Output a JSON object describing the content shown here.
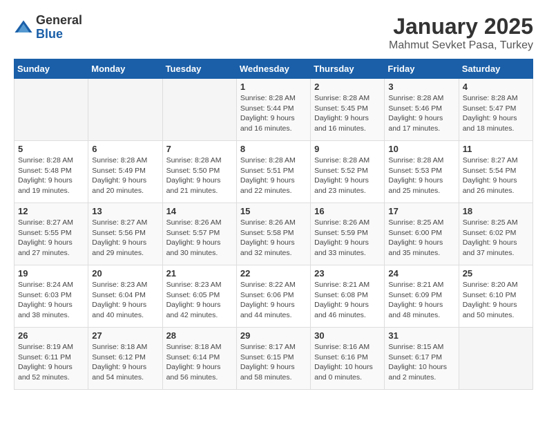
{
  "logo": {
    "general": "General",
    "blue": "Blue"
  },
  "title": "January 2025",
  "subtitle": "Mahmut Sevket Pasa, Turkey",
  "days_of_week": [
    "Sunday",
    "Monday",
    "Tuesday",
    "Wednesday",
    "Thursday",
    "Friday",
    "Saturday"
  ],
  "weeks": [
    [
      {
        "day": "",
        "sunrise": "",
        "sunset": "",
        "daylight": ""
      },
      {
        "day": "",
        "sunrise": "",
        "sunset": "",
        "daylight": ""
      },
      {
        "day": "",
        "sunrise": "",
        "sunset": "",
        "daylight": ""
      },
      {
        "day": "1",
        "sunrise": "Sunrise: 8:28 AM",
        "sunset": "Sunset: 5:44 PM",
        "daylight": "Daylight: 9 hours and 16 minutes."
      },
      {
        "day": "2",
        "sunrise": "Sunrise: 8:28 AM",
        "sunset": "Sunset: 5:45 PM",
        "daylight": "Daylight: 9 hours and 16 minutes."
      },
      {
        "day": "3",
        "sunrise": "Sunrise: 8:28 AM",
        "sunset": "Sunset: 5:46 PM",
        "daylight": "Daylight: 9 hours and 17 minutes."
      },
      {
        "day": "4",
        "sunrise": "Sunrise: 8:28 AM",
        "sunset": "Sunset: 5:47 PM",
        "daylight": "Daylight: 9 hours and 18 minutes."
      }
    ],
    [
      {
        "day": "5",
        "sunrise": "Sunrise: 8:28 AM",
        "sunset": "Sunset: 5:48 PM",
        "daylight": "Daylight: 9 hours and 19 minutes."
      },
      {
        "day": "6",
        "sunrise": "Sunrise: 8:28 AM",
        "sunset": "Sunset: 5:49 PM",
        "daylight": "Daylight: 9 hours and 20 minutes."
      },
      {
        "day": "7",
        "sunrise": "Sunrise: 8:28 AM",
        "sunset": "Sunset: 5:50 PM",
        "daylight": "Daylight: 9 hours and 21 minutes."
      },
      {
        "day": "8",
        "sunrise": "Sunrise: 8:28 AM",
        "sunset": "Sunset: 5:51 PM",
        "daylight": "Daylight: 9 hours and 22 minutes."
      },
      {
        "day": "9",
        "sunrise": "Sunrise: 8:28 AM",
        "sunset": "Sunset: 5:52 PM",
        "daylight": "Daylight: 9 hours and 23 minutes."
      },
      {
        "day": "10",
        "sunrise": "Sunrise: 8:28 AM",
        "sunset": "Sunset: 5:53 PM",
        "daylight": "Daylight: 9 hours and 25 minutes."
      },
      {
        "day": "11",
        "sunrise": "Sunrise: 8:27 AM",
        "sunset": "Sunset: 5:54 PM",
        "daylight": "Daylight: 9 hours and 26 minutes."
      }
    ],
    [
      {
        "day": "12",
        "sunrise": "Sunrise: 8:27 AM",
        "sunset": "Sunset: 5:55 PM",
        "daylight": "Daylight: 9 hours and 27 minutes."
      },
      {
        "day": "13",
        "sunrise": "Sunrise: 8:27 AM",
        "sunset": "Sunset: 5:56 PM",
        "daylight": "Daylight: 9 hours and 29 minutes."
      },
      {
        "day": "14",
        "sunrise": "Sunrise: 8:26 AM",
        "sunset": "Sunset: 5:57 PM",
        "daylight": "Daylight: 9 hours and 30 minutes."
      },
      {
        "day": "15",
        "sunrise": "Sunrise: 8:26 AM",
        "sunset": "Sunset: 5:58 PM",
        "daylight": "Daylight: 9 hours and 32 minutes."
      },
      {
        "day": "16",
        "sunrise": "Sunrise: 8:26 AM",
        "sunset": "Sunset: 5:59 PM",
        "daylight": "Daylight: 9 hours and 33 minutes."
      },
      {
        "day": "17",
        "sunrise": "Sunrise: 8:25 AM",
        "sunset": "Sunset: 6:00 PM",
        "daylight": "Daylight: 9 hours and 35 minutes."
      },
      {
        "day": "18",
        "sunrise": "Sunrise: 8:25 AM",
        "sunset": "Sunset: 6:02 PM",
        "daylight": "Daylight: 9 hours and 37 minutes."
      }
    ],
    [
      {
        "day": "19",
        "sunrise": "Sunrise: 8:24 AM",
        "sunset": "Sunset: 6:03 PM",
        "daylight": "Daylight: 9 hours and 38 minutes."
      },
      {
        "day": "20",
        "sunrise": "Sunrise: 8:23 AM",
        "sunset": "Sunset: 6:04 PM",
        "daylight": "Daylight: 9 hours and 40 minutes."
      },
      {
        "day": "21",
        "sunrise": "Sunrise: 8:23 AM",
        "sunset": "Sunset: 6:05 PM",
        "daylight": "Daylight: 9 hours and 42 minutes."
      },
      {
        "day": "22",
        "sunrise": "Sunrise: 8:22 AM",
        "sunset": "Sunset: 6:06 PM",
        "daylight": "Daylight: 9 hours and 44 minutes."
      },
      {
        "day": "23",
        "sunrise": "Sunrise: 8:21 AM",
        "sunset": "Sunset: 6:08 PM",
        "daylight": "Daylight: 9 hours and 46 minutes."
      },
      {
        "day": "24",
        "sunrise": "Sunrise: 8:21 AM",
        "sunset": "Sunset: 6:09 PM",
        "daylight": "Daylight: 9 hours and 48 minutes."
      },
      {
        "day": "25",
        "sunrise": "Sunrise: 8:20 AM",
        "sunset": "Sunset: 6:10 PM",
        "daylight": "Daylight: 9 hours and 50 minutes."
      }
    ],
    [
      {
        "day": "26",
        "sunrise": "Sunrise: 8:19 AM",
        "sunset": "Sunset: 6:11 PM",
        "daylight": "Daylight: 9 hours and 52 minutes."
      },
      {
        "day": "27",
        "sunrise": "Sunrise: 8:18 AM",
        "sunset": "Sunset: 6:12 PM",
        "daylight": "Daylight: 9 hours and 54 minutes."
      },
      {
        "day": "28",
        "sunrise": "Sunrise: 8:18 AM",
        "sunset": "Sunset: 6:14 PM",
        "daylight": "Daylight: 9 hours and 56 minutes."
      },
      {
        "day": "29",
        "sunrise": "Sunrise: 8:17 AM",
        "sunset": "Sunset: 6:15 PM",
        "daylight": "Daylight: 9 hours and 58 minutes."
      },
      {
        "day": "30",
        "sunrise": "Sunrise: 8:16 AM",
        "sunset": "Sunset: 6:16 PM",
        "daylight": "Daylight: 10 hours and 0 minutes."
      },
      {
        "day": "31",
        "sunrise": "Sunrise: 8:15 AM",
        "sunset": "Sunset: 6:17 PM",
        "daylight": "Daylight: 10 hours and 2 minutes."
      },
      {
        "day": "",
        "sunrise": "",
        "sunset": "",
        "daylight": ""
      }
    ]
  ]
}
